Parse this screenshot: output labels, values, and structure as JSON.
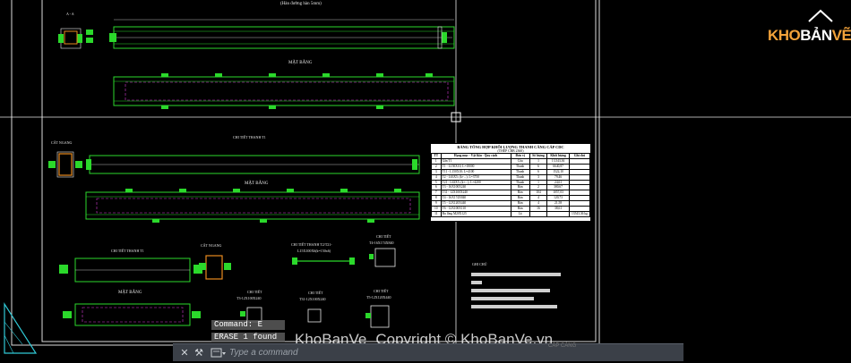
{
  "drawing": {
    "note_top": "(Hàn đường hàn 5mm)",
    "section_aa": "A - A",
    "mat_bang_1": "MẶT BẰNG",
    "cat_ngang_1": "CẮT NGANG",
    "chi_tiet_t1": "CHI TIẾT THANH T1",
    "mat_bang_2": "MẶT BẰNG",
    "chi_tiet_t1_b": "CHI TIẾT THANH T1",
    "cat_ngang_2": "CẮT NGANG",
    "chi_tiet_t2": "CHI TIẾT THANH T2/T21-",
    "chi_tiet_t2_sub": "L15X100X6(k=150x6)",
    "chi_tiet_small": "CHI TIẾT",
    "chi_tiet_small_sub": "T4-16X174X840",
    "mat_bang_3": "MẶT BẰNG",
    "ct_t3": "CHI TIẾT",
    "ct_t3_sub": "T3-12X100X240",
    "ct_t31": "CHI TIẾT",
    "ct_t31_sub": "T31-12X100X240",
    "ct_t5": "CHI TIẾT",
    "ct_t5_sub": "T5-12X120X440",
    "ghi_chu": "GHI CHÚ"
  },
  "table": {
    "title": "BẢNG TỔNG HỢP KHỐI LƯỢNG THANH CĂNG CÁP CDC",
    "subtitle": "(THÉP CBB 2360)",
    "headers": [
      "TT",
      "Hạng mục - Vật liệu - Quy cách",
      "Đơn vị",
      "Số lượng",
      "Khối lượng",
      "Ghi chú"
    ],
    "rows": [
      [
        "1",
        "Gắn T1",
        "Cấu",
        "1",
        "13.543,36",
        ""
      ],
      [
        "2",
        "T1 - L150X10; L=18000",
        "Thanh",
        "6",
        "6640,87",
        ""
      ],
      [
        "3",
        "T11 - L150X10; L=4100",
        "Thanh",
        "6",
        "1522,10",
        ""
      ],
      [
        "4",
        "T2 - L63X5; (k+...); L=3750",
        "Thanh",
        "3",
        "79,46",
        ""
      ],
      [
        "5",
        "T21 - L63X5; (k+...); L=4200",
        "Thanh",
        "1",
        "24,61",
        ""
      ],
      [
        "6",
        "T3 - 16X100X240",
        "Bản",
        "2",
        "380,67",
        ""
      ],
      [
        "7",
        "T31 - 12X100X240",
        "Bản",
        "104",
        "1057,03",
        ""
      ],
      [
        "8",
        "T4 - 16X174X840",
        "Bản",
        "4",
        "120,73",
        ""
      ],
      [
        "9",
        "T5 - 12X120X440",
        "Bản",
        "4",
        "21,58",
        ""
      ],
      [
        "10",
        "T6 - 12X100X110",
        "Bản",
        "16",
        "38,61",
        ""
      ],
      [
        "11",
        "Bu lông M20X125",
        "Lá",
        "",
        "",
        "13543,36 kg"
      ]
    ]
  },
  "command": {
    "history_1": "Command: E",
    "history_2": "ERASE 1 found",
    "placeholder": "Type a command",
    "close_label": "✕",
    "customize_label": "⚒",
    "recent_label": "▾"
  },
  "brand": {
    "logo_text": "KHOBANVE",
    "logo_accent": "KHO",
    "logo_tail": "BẢN",
    "logo_end": "VẼ",
    "watermark_1": "KhoBanVe",
    "watermark_2": "Copyright © KhoBanVe.vn",
    "bottom_label": "CÁP CĂNG"
  },
  "colors": {
    "green": "#2bd92b",
    "magenta": "#d43ad4",
    "white": "#e8e8e8",
    "cyan": "#31c9d6",
    "background": "#000000"
  }
}
